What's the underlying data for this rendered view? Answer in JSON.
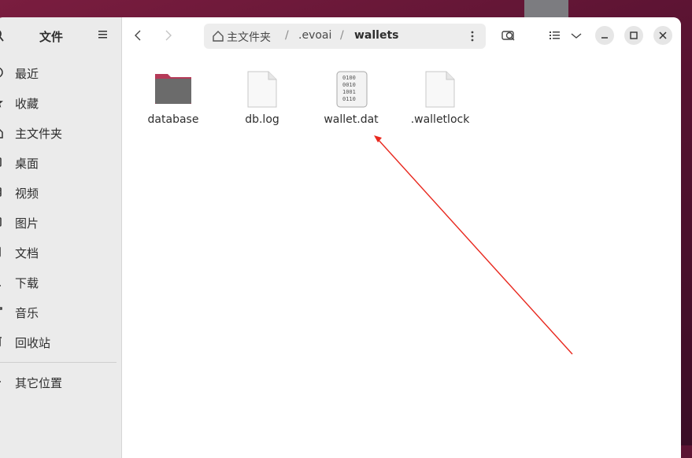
{
  "sidebar": {
    "title": "文件",
    "items": [
      {
        "label": "最近",
        "icon": "clock-icon"
      },
      {
        "label": "收藏",
        "icon": "star-icon"
      },
      {
        "label": "主文件夹",
        "icon": "home-icon"
      },
      {
        "label": "桌面",
        "icon": "desktop-icon"
      },
      {
        "label": "视频",
        "icon": "video-icon"
      },
      {
        "label": "图片",
        "icon": "image-icon"
      },
      {
        "label": "文档",
        "icon": "document-icon"
      },
      {
        "label": "下载",
        "icon": "download-icon"
      },
      {
        "label": "音乐",
        "icon": "music-icon"
      },
      {
        "label": "回收站",
        "icon": "trash-icon"
      }
    ],
    "other": {
      "label": "其它位置",
      "icon": "plus-icon"
    }
  },
  "pathbar": {
    "home": "主文件夹",
    "segment1": ".evoai",
    "current": "wallets",
    "sep": "/"
  },
  "files": [
    {
      "name": "database",
      "icon": "folder-icon"
    },
    {
      "name": "db.log",
      "icon": "text-file-icon"
    },
    {
      "name": "wallet.dat",
      "icon": "binary-file-icon"
    },
    {
      "name": ".walletlock",
      "icon": "text-file-icon"
    }
  ],
  "binary_glyph": [
    "0100",
    "0010",
    "1001",
    "0110"
  ],
  "colors": {
    "folder": "#6b6b6b",
    "folder_tab": "#b53a58",
    "annotation_arrow": "#e8281e"
  }
}
